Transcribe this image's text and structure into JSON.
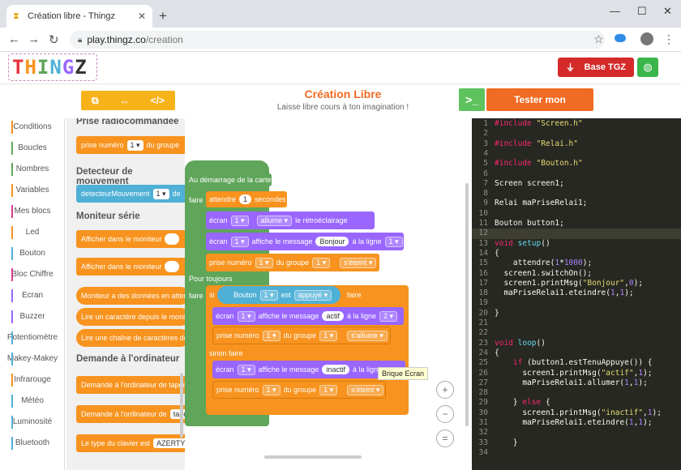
{
  "browser": {
    "tab_title": "Création libre - Thingz",
    "url_host": "play.thingz.co",
    "url_path": "/creation"
  },
  "header": {
    "logo": "THINGZ",
    "base_button": "Base TGZ"
  },
  "toolbar": {
    "title": "Création Libre",
    "subtitle": "Laisse libre cours à ton imagination !",
    "test_button": "Tester mon programme",
    "terminal_glyph": ">_"
  },
  "categories": [
    {
      "label": "Conditions",
      "color": "#f7931e"
    },
    {
      "label": "Boucles",
      "color": "#5fa55a"
    },
    {
      "label": "Nombres",
      "color": "#5fa55a"
    },
    {
      "label": "Variables",
      "color": "#f7931e"
    },
    {
      "label": "Mes blocs",
      "color": "#d63c8c"
    },
    {
      "label": "Led",
      "color": "#f7931e"
    },
    {
      "label": "Bouton",
      "color": "#4fb0d6"
    },
    {
      "label": "Bloc Chiffre",
      "color": "#d63c8c"
    },
    {
      "label": "Ecran",
      "color": "#9966ff"
    },
    {
      "label": "Buzzer",
      "color": "#9966ff"
    },
    {
      "label": "Potentiomètre",
      "color": "#4fb0d6"
    },
    {
      "label": "Makey-Makey",
      "color": "#4fb0d6"
    },
    {
      "label": "Infrarouge",
      "color": "#f7931e"
    },
    {
      "label": "Météo",
      "color": "#4fb0d6"
    },
    {
      "label": "Luminosité",
      "color": "#4fb0d6"
    },
    {
      "label": "Bluetooth",
      "color": "#4fb0d6"
    }
  ],
  "flyout": {
    "sec_radio": "Prise radiocommandée",
    "radio_block": "prise numéro",
    "radio_dd": "1 ▾",
    "radio_group": "du groupe",
    "sec_motion": "Detecteur de mouvement",
    "motion_block": "detecteurMouvement",
    "motion_dd": "1 ▾",
    "motion_tail": "de",
    "sec_serial": "Moniteur série",
    "serial1": "Afficher dans le moniteur",
    "serial2": "Afficher dans le moniteur",
    "serial3": "Moniteur a des données en attente",
    "serial4": "Lire un caractère depuis le moniteur",
    "serial5": "Lire une chaîne de caractères depuis",
    "sec_computer": "Demande à l'ordinateur",
    "comp1": "Demande à l'ordinateur de taper",
    "comp2": "Demande à l'ordinateur de",
    "comp2_tail": "taper",
    "comp3": "Le type du clavier est",
    "comp3_dd": "AZERTY"
  },
  "workspace": {
    "start": "Au démarrage de la carte",
    "do": "faire",
    "wait": "attendre",
    "wait_val": "1",
    "seconds": "secondes",
    "screen": "écran",
    "one": "1 ▾",
    "two": "2 ▾",
    "turn_on": "allume ▾",
    "backlight": "le rétroéclairage",
    "show_msg": "affiche le message",
    "msg1": "Bonjour",
    "at_line": "à la ligne",
    "plug": "prise numéro",
    "group": "du groupe",
    "off": "s'éteint ▾",
    "on": "s'allume ▾",
    "forever": "Pour toujours",
    "if": "si",
    "button": "Bouton",
    "is": "est",
    "pressed": "appuyé ▾",
    "then": "faire",
    "msg2": "actif",
    "else": "sinon faire",
    "msg3": "inactif",
    "tooltip": "Brique Ecran"
  },
  "zoom": {
    "in": "+",
    "out": "−",
    "reset": "="
  },
  "code_lines": [
    "#include \"Screen.h\"",
    "",
    "#include \"Relai.h\"",
    "",
    "#include \"Bouton.h\"",
    "",
    "Screen screen1;",
    "",
    "Relai maPriseRelai1;",
    "",
    "Bouton button1;",
    "",
    "void setup()",
    "{",
    "    attendre(1*1000);",
    "  screen1.switchOn();",
    "  screen1.printMsg(\"Bonjour\",0);",
    "  maPriseRelai1.eteindre(1,1);",
    "",
    "}",
    "",
    "",
    "void loop()",
    "{",
    "    if (button1.estTenuAppuye()) {",
    "      screen1.printMsg(\"actif\",1);",
    "      maPriseRelai1.allumer(1,1);",
    "",
    "    } else {",
    "      screen1.printMsg(\"inactif\",1);",
    "      maPriseRelai1.eteindre(1,1);",
    "",
    "    }",
    ""
  ]
}
